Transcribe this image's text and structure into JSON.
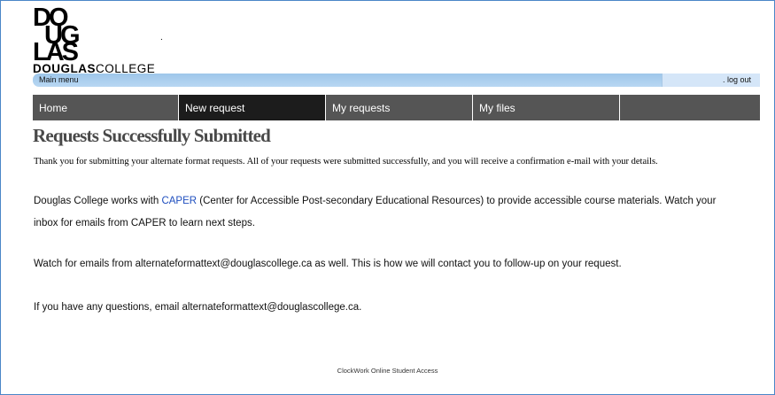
{
  "logo": {
    "brand": "DOUGLAS",
    "brand_suffix": "COLLEGE",
    "mark_lines": [
      "DO",
      "UG",
      "LAS"
    ]
  },
  "menubar": {
    "main_menu": "Main menu",
    "log_out": ". log out"
  },
  "nav": {
    "tabs": [
      {
        "label": "Home",
        "active": false
      },
      {
        "label": "New request",
        "active": true
      },
      {
        "label": "My requests",
        "active": false
      },
      {
        "label": "My files",
        "active": false
      },
      {
        "label": "",
        "active": false
      }
    ]
  },
  "main": {
    "title": "Requests Successfully Submitted",
    "intro": "Thank you for submitting your alternate format requests. All of your requests were submitted successfully, and you will receive a confirmation e-mail with your details.",
    "p1_before": "Douglas College works with ",
    "p1_link": "CAPER",
    "p1_after": " (Center for Accessible Post-secondary Educational Resources) to provide accessible course materials. Watch your",
    "p1_line2": "inbox for emails from CAPER to learn next steps.",
    "p2": "Watch for emails from alternateformattext@douglascollege.ca as well. This is how we will contact you to follow-up on your request.",
    "p3": "If you have any questions, email alternateformattext@douglascollege.ca."
  },
  "footer": {
    "text": "ClockWork Online Student Access"
  },
  "colors": {
    "link": "#1f4fbf",
    "nav_bg": "#555555",
    "nav_active": "#1c1c1c",
    "menubar": "#aacff0",
    "title": "#494949",
    "border": "#4a86c8"
  }
}
